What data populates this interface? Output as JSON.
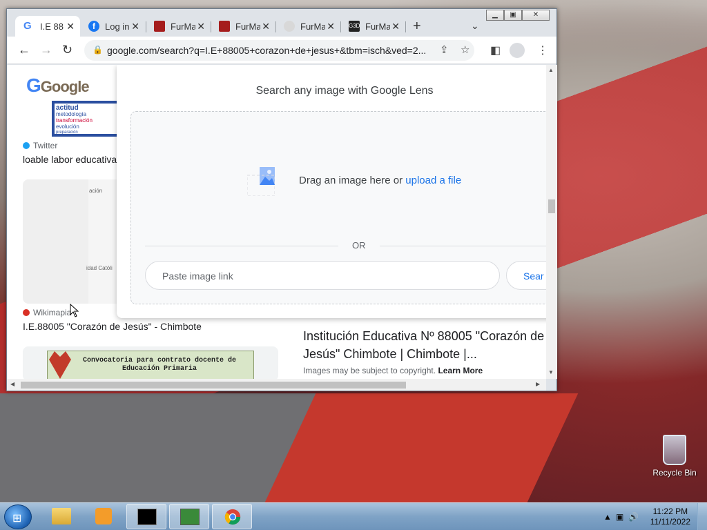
{
  "browser": {
    "tabs": [
      {
        "title": "I.E 88",
        "fav_color": "#ffffff",
        "fav_icon": "google-icon",
        "active": true
      },
      {
        "title": "Log in",
        "fav_color": "#1877f2",
        "fav_icon": "facebook-icon",
        "active": false
      },
      {
        "title": "FurMa",
        "fav_color": "#a51c1c",
        "fav_icon": "furmark-icon",
        "active": false
      },
      {
        "title": "FurMa",
        "fav_color": "#a51c1c",
        "fav_icon": "furmark-icon",
        "active": false
      },
      {
        "title": "FurMa",
        "fav_color": "#d8d8d8",
        "fav_icon": "loading-icon",
        "active": false
      },
      {
        "title": "FurMa",
        "fav_color": "#222222",
        "fav_icon": "g3d-icon",
        "active": false
      }
    ],
    "url": "google.com/search?q=I.E+88005+corazon+de+jesus+&tbm=isch&ved=2..."
  },
  "page": {
    "logo": "Google",
    "results": [
      {
        "source": "Twitter",
        "title": "loable labor educativa",
        "source_color": "#1da1f2"
      },
      {
        "source": "Wikimapia",
        "title": "I.E.88005 \"Corazón de Jesús\" - Chimbote",
        "source_color": "#d93025"
      }
    ],
    "left_thumb_text": [
      "actitud",
      "metodología",
      "transformación",
      "evolución",
      "preparación"
    ],
    "map_labels": [
      "ación",
      "idad Católi"
    ],
    "bottom_thumb_text": "Convocatoria para contrato docente de Educación Primaria",
    "main_result_title": "Institución Educativa Nº 88005 \"Corazón de Jesús\" Chimbote | Chimbote |...",
    "copyright_text": "Images may be subject to copyright.",
    "learn_more": "Learn More"
  },
  "lens": {
    "title": "Search any image with Google Lens",
    "drag_text": "Drag an image here or",
    "upload_link": "upload a file",
    "or": "OR",
    "paste_placeholder": "Paste image link",
    "search_button": "Sear"
  },
  "desktop": {
    "recycle_bin": "Recycle Bin"
  },
  "taskbar": {
    "time": "11:22 PM",
    "date": "11/11/2022"
  }
}
